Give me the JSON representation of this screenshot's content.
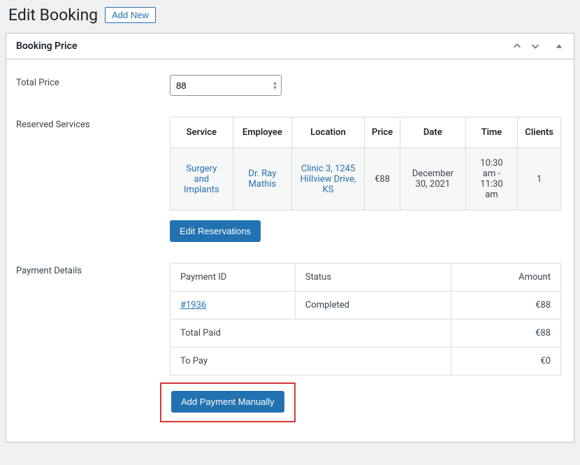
{
  "header": {
    "title": "Edit Booking",
    "add_new_label": "Add New"
  },
  "panel": {
    "title": "Booking Price"
  },
  "total_price": {
    "label": "Total Price",
    "value": "88"
  },
  "reserved_services": {
    "label": "Reserved Services",
    "headers": {
      "service": "Service",
      "employee": "Employee",
      "location": "Location",
      "price": "Price",
      "date": "Date",
      "time": "Time",
      "clients": "Clients"
    },
    "rows": [
      {
        "service": "Surgery and Implants",
        "employee": "Dr. Ray Mathis",
        "location": "Clinic 3, 1245 Hillview Drive, KS",
        "price": "€88",
        "date": "December 30, 2021",
        "time": "10:30 am - 11:30 am",
        "clients": "1"
      }
    ],
    "edit_button": "Edit Reservations"
  },
  "payment_details": {
    "label": "Payment Details",
    "headers": {
      "payment_id": "Payment ID",
      "status": "Status",
      "amount": "Amount"
    },
    "rows": [
      {
        "payment_id": "#1936",
        "status": "Completed",
        "amount": "€88"
      }
    ],
    "totals": {
      "total_paid_label": "Total Paid",
      "total_paid_value": "€88",
      "to_pay_label": "To Pay",
      "to_pay_value": "€0"
    },
    "add_button": "Add Payment Manually"
  }
}
